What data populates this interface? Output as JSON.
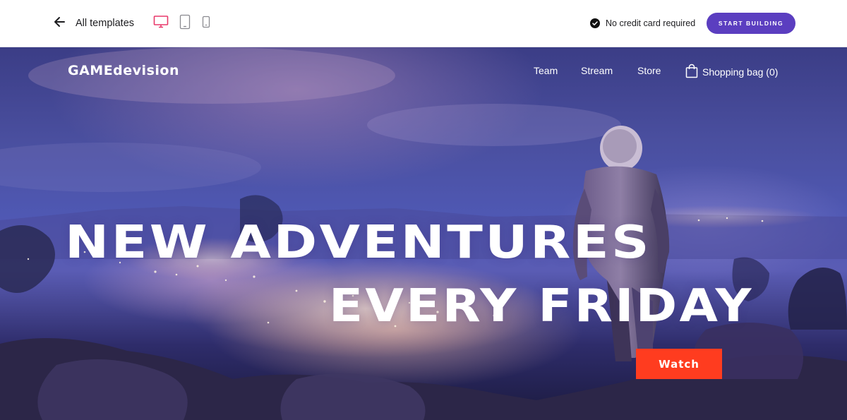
{
  "topbar": {
    "back_label": "All templates",
    "back_icon": "arrow-left-icon",
    "devices": [
      {
        "name": "desktop",
        "icon": "monitor-icon",
        "active": true
      },
      {
        "name": "tablet",
        "icon": "tablet-icon",
        "active": false
      },
      {
        "name": "phone",
        "icon": "phone-icon",
        "active": false
      }
    ],
    "no_credit_card": "No credit card required",
    "start_button": "START BUILDING",
    "accent_color": "#5b3ec0",
    "active_device_color": "#e8396b"
  },
  "hero": {
    "brand": "GAMEdevision",
    "nav": {
      "team": "Team",
      "stream": "Stream",
      "store": "Store",
      "bag": "Shopping bag (0)"
    },
    "headline_line1": "NEW ADVENTURES",
    "headline_line2": "EVERY FRIDAY",
    "watch_button": "Watch",
    "watch_color": "#ff3c1f"
  }
}
